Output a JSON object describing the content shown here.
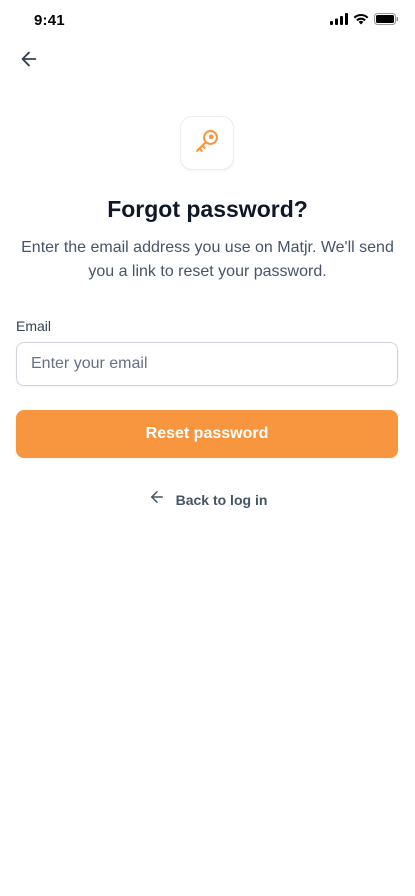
{
  "status_bar": {
    "time": "9:41",
    "icons": [
      "signal-icon",
      "wifi-icon",
      "battery-icon"
    ]
  },
  "nav": {
    "back_icon": "arrow-left-icon"
  },
  "header": {
    "icon": "key-icon",
    "title": "Forgot password?",
    "subtitle": "Enter the email address you use on Matjr. We'll send you a link to reset your password."
  },
  "form": {
    "email_label": "Email",
    "email_value": "",
    "email_placeholder": "Enter your email",
    "submit_label": "Reset password"
  },
  "footer": {
    "back_icon": "arrow-left-icon",
    "back_label": "Back to log in"
  },
  "colors": {
    "accent": "#F8963F",
    "heading": "#101828",
    "body_text": "#475467",
    "border": "#D0D5DD"
  }
}
